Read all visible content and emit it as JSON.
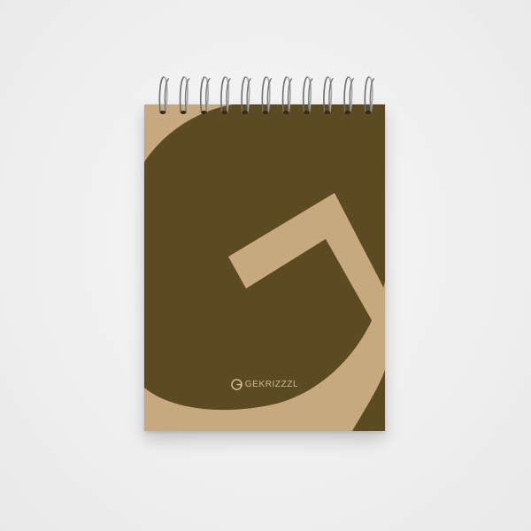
{
  "brand": {
    "name": "GEKRIZZZL",
    "logo_icon": "g-monogram-icon"
  },
  "colors": {
    "background": "#f0f0f0",
    "kraft": "#c7a980",
    "dark_brown": "#5b4a22",
    "wire": "#8a8a8a"
  }
}
